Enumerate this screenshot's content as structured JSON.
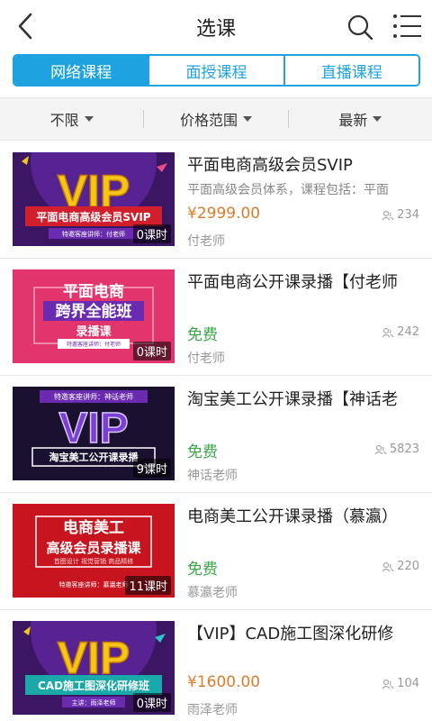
{
  "header": {
    "title": "选课"
  },
  "tabs": [
    {
      "label": "网络课程",
      "active": true
    },
    {
      "label": "面授课程",
      "active": false
    },
    {
      "label": "直播课程",
      "active": false
    }
  ],
  "filters": [
    {
      "label": "不限"
    },
    {
      "label": "价格范围"
    },
    {
      "label": "最新"
    }
  ],
  "courses": [
    {
      "title": "平面电商高级会员SVIP",
      "desc": "平面高级会员体系，课程包括：平面",
      "price": "¥2999.00",
      "views": "234",
      "teacher": "付老师",
      "lessons": "0课时",
      "thumb": {
        "big": "VIP",
        "banner": "平面电商高级会员SVIP",
        "sub": "特邀客座讲师：付老师"
      }
    },
    {
      "title": "平面电商公开课录播【付老师",
      "desc": "",
      "price": "免费",
      "views": "242",
      "teacher": "付老师",
      "lessons": "0课时",
      "thumb": {
        "line1": "平面电商",
        "line2": "跨界全能班",
        "line3": "录播课",
        "sub": "特邀客座讲师：付老师"
      }
    },
    {
      "title": "淘宝美工公开课录播【神话老",
      "desc": "",
      "price": "免费",
      "views": "5823",
      "teacher": "神话老师",
      "lessons": "9课时",
      "thumb": {
        "top": "特邀客座讲师：神话老师",
        "big": "VIP",
        "banner": "淘宝美工公开课录播"
      }
    },
    {
      "title": "电商美工公开课录播（慕瀛）",
      "desc": "",
      "price": "免费",
      "views": "220",
      "teacher": "慕瀛老师",
      "lessons": "11课时",
      "thumb": {
        "line1": "电商美工",
        "line2": "高级会员录播课",
        "line3": "首图设计  视觉营销  商品精修",
        "sub": "特邀客座讲师：慕瀛老师"
      }
    },
    {
      "title": "【VIP】CAD施工图深化研修",
      "desc": "",
      "price": "¥1600.00",
      "views": "104",
      "teacher": "雨泽老师",
      "lessons": "0课时",
      "thumb": {
        "big": "VIP",
        "banner": "CAD施工图深化研修班",
        "sub": "主讲：雨泽老师"
      }
    }
  ],
  "colors": {
    "accent": "#1fa2e0",
    "price": "#e07b2a",
    "free": "#3aa84a"
  }
}
